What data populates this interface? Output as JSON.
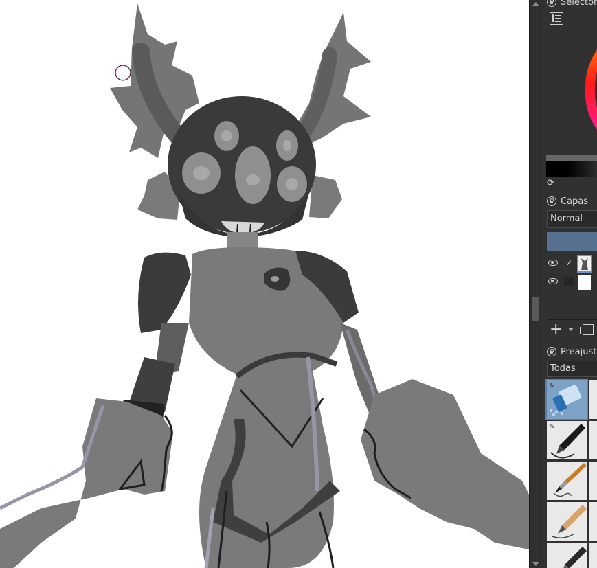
{
  "dock": {
    "color_selector": {
      "title": "Selector"
    },
    "layers": {
      "title": "Capas",
      "blend_mode": "Normal",
      "rows": [
        {
          "visible": true,
          "checked": true,
          "check_glyph": "✓",
          "selected": true
        },
        {
          "visible": true,
          "checked": false,
          "check_glyph": "",
          "selected": false
        }
      ]
    },
    "presets": {
      "title": "Preajustes",
      "filter": "Todas",
      "brushes": [
        {
          "icon": "eraser-brush-icon",
          "selected": true
        },
        {
          "icon": "ink-pen-brush-icon",
          "selected": false
        },
        {
          "icon": "paintbrush-icon",
          "selected": false
        },
        {
          "icon": "pencil-brush-icon",
          "selected": false
        },
        {
          "icon": "marker-brush-icon",
          "selected": false
        }
      ]
    }
  },
  "colors": {
    "panel": "#313131",
    "accent": "#56708f",
    "figure_light": "#7a7a7a",
    "figure_dark": "#333333"
  }
}
